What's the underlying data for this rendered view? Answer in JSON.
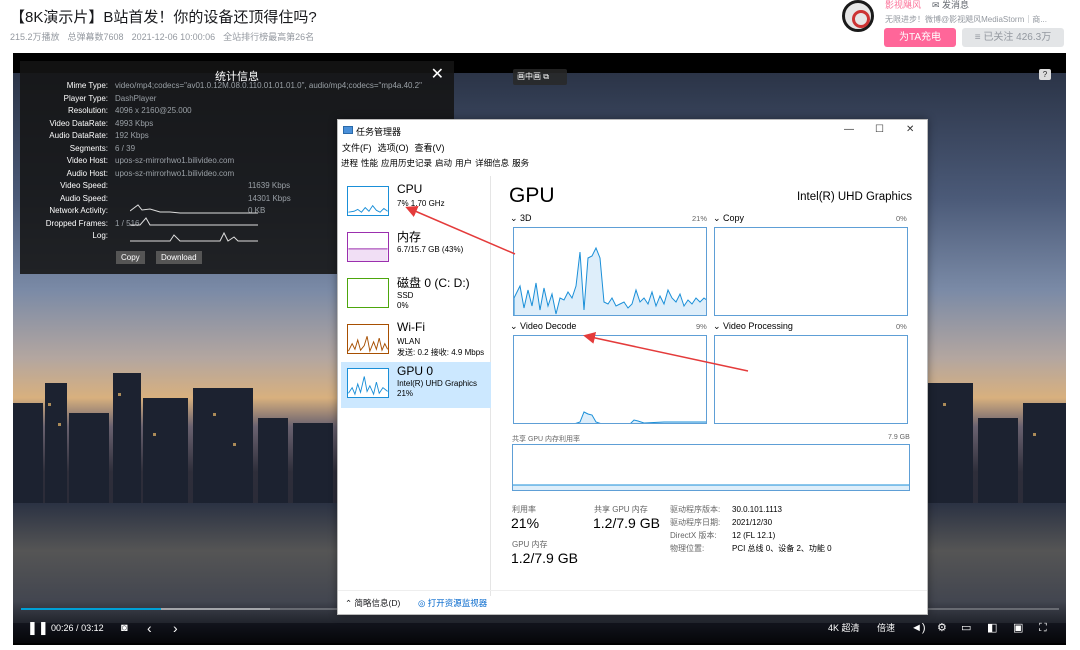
{
  "page": {
    "title": "【8K演示片】B站首发！你的设备还顶得住吗?",
    "plays": "215.2万播放",
    "danmaku": "总弹幕数7608",
    "date": "2021-12-06 10:00:06",
    "rank": "全站排行榜最高第26名"
  },
  "uploader": {
    "name": "影视飓风",
    "message": "发消息",
    "desc": "无限进步！微博@影视飓风MediaStorm｜商...",
    "charge": "为TA充电",
    "follow": "≡ 已关注 426.3万"
  },
  "player": {
    "pip": "画中画",
    "help": "?",
    "stats": {
      "title": "统计信息",
      "close": "✕",
      "rows": [
        {
          "k": "Mime Type:",
          "v": "video/mp4;codecs=\"av01.0.12M.08.0.110.01.01.01.0\", audio/mp4;codecs=\"mp4a.40.2\""
        },
        {
          "k": "Player Type:",
          "v": "DashPlayer"
        },
        {
          "k": "Resolution:",
          "v": "4096 x 2160@25.000"
        },
        {
          "k": "Video DataRate:",
          "v": "4993 Kbps"
        },
        {
          "k": "Audio DataRate:",
          "v": "192 Kbps"
        },
        {
          "k": "Segments:",
          "v": "6 / 39"
        },
        {
          "k": "Video Host:",
          "v": "upos-sz-mirrorhwo1.bilivideo.com"
        },
        {
          "k": "Audio Host:",
          "v": "upos-sz-mirrorhwo1.bilivideo.com"
        },
        {
          "k": "Video Speed:",
          "v": "11639 Kbps"
        },
        {
          "k": "Audio Speed:",
          "v": "14301 Kbps"
        },
        {
          "k": "Network Activity:",
          "v": "0 KB"
        },
        {
          "k": "Dropped Frames:",
          "v": "1 / 516"
        },
        {
          "k": "Log:",
          "v": ""
        }
      ],
      "copy": "Copy",
      "download": "Download"
    },
    "time_current": "00:26",
    "time_sep": "/",
    "time_total": "03:12",
    "progress": 0.135,
    "buffered": 0.24,
    "quality": "4K 超清",
    "speed": "倍速"
  },
  "taskmgr": {
    "title": "任务管理器",
    "menu": [
      "文件(F)",
      "选项(O)",
      "查看(V)"
    ],
    "tabs": [
      "进程",
      "性能",
      "应用历史记录",
      "启动",
      "用户",
      "详细信息",
      "服务"
    ],
    "side": [
      {
        "name": "CPU",
        "sub1": "7% 1.70 GHz",
        "sub2": ""
      },
      {
        "name": "内存",
        "sub1": "6.7/15.7 GB (43%)",
        "sub2": ""
      },
      {
        "name": "磁盘 0 (C: D:)",
        "sub1": "SSD",
        "sub2": "0%"
      },
      {
        "name": "Wi-Fi",
        "sub1": "WLAN",
        "sub2": "发送: 0.2  接收: 4.9 Mbps"
      },
      {
        "name": "GPU 0",
        "sub1": "Intel(R) UHD Graphics",
        "sub2": "21%"
      }
    ],
    "gpu": {
      "heading": "GPU",
      "model": "Intel(R) UHD Graphics",
      "g3d": "3D",
      "g3d_pct": "21%",
      "copy": "Copy",
      "copy_pct": "0%",
      "vdec": "Video Decode",
      "vdec_pct": "9%",
      "vproc": "Video Processing",
      "vproc_pct": "0%",
      "shared_label": "共享 GPU 内存利用率",
      "shared_max": "7.9 GB",
      "util_label": "利用率",
      "util_val": "21%",
      "shared_mem_label": "共享 GPU 内存",
      "shared_mem_val": "1.2/7.9 GB",
      "gpu_mem_label": "GPU 内存",
      "gpu_mem_val": "1.2/7.9 GB",
      "driver_ver_k": "驱动程序版本:",
      "driver_ver_v": "30.0.101.1113",
      "driver_date_k": "驱动程序日期:",
      "driver_date_v": "2021/12/30",
      "dx_k": "DirectX 版本:",
      "dx_v": "12 (FL 12.1)",
      "loc_k": "物理位置:",
      "loc_v": "PCI 总线 0、设备 2、功能 0"
    },
    "footer_brief": "简略信息(D)",
    "footer_link": "打开资源监视器"
  }
}
